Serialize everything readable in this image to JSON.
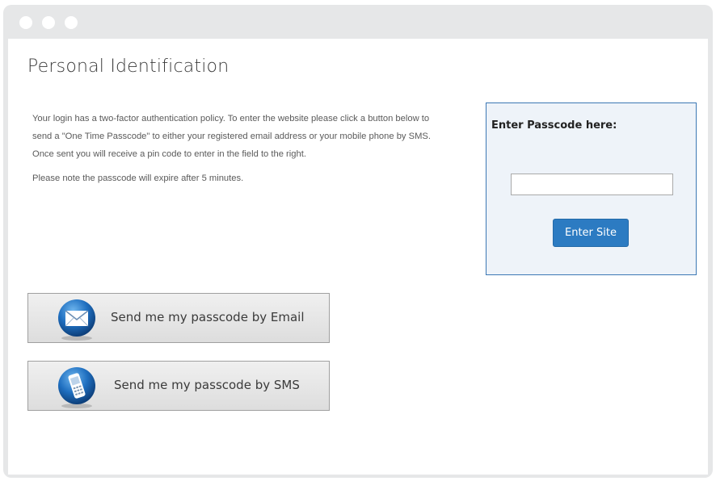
{
  "page": {
    "title": "Personal Identification"
  },
  "intro": {
    "line1": "Your login has a two-factor authentication policy. To enter the website please click a button below to",
    "line2": "send a \"One Time Passcode\" to either your registered email address or your mobile phone by SMS.",
    "line3": "Once sent you will receive a pin code to enter in the field to the right.",
    "note": "Please note the passcode will expire after 5 minutes."
  },
  "passcode_panel": {
    "title": "Enter Passcode here:",
    "input_value": "",
    "button_label": "Enter Site"
  },
  "send_buttons": {
    "email_label": "Send me my passcode by Email",
    "email_icon": "envelope-icon",
    "sms_label": "Send me my passcode by SMS",
    "sms_icon": "mobile-phone-icon"
  },
  "colors": {
    "accent": "#2c7bc2",
    "panel_border": "#3c78b4",
    "panel_background": "#eef3f9",
    "window_chrome": "#e6e7e8"
  }
}
